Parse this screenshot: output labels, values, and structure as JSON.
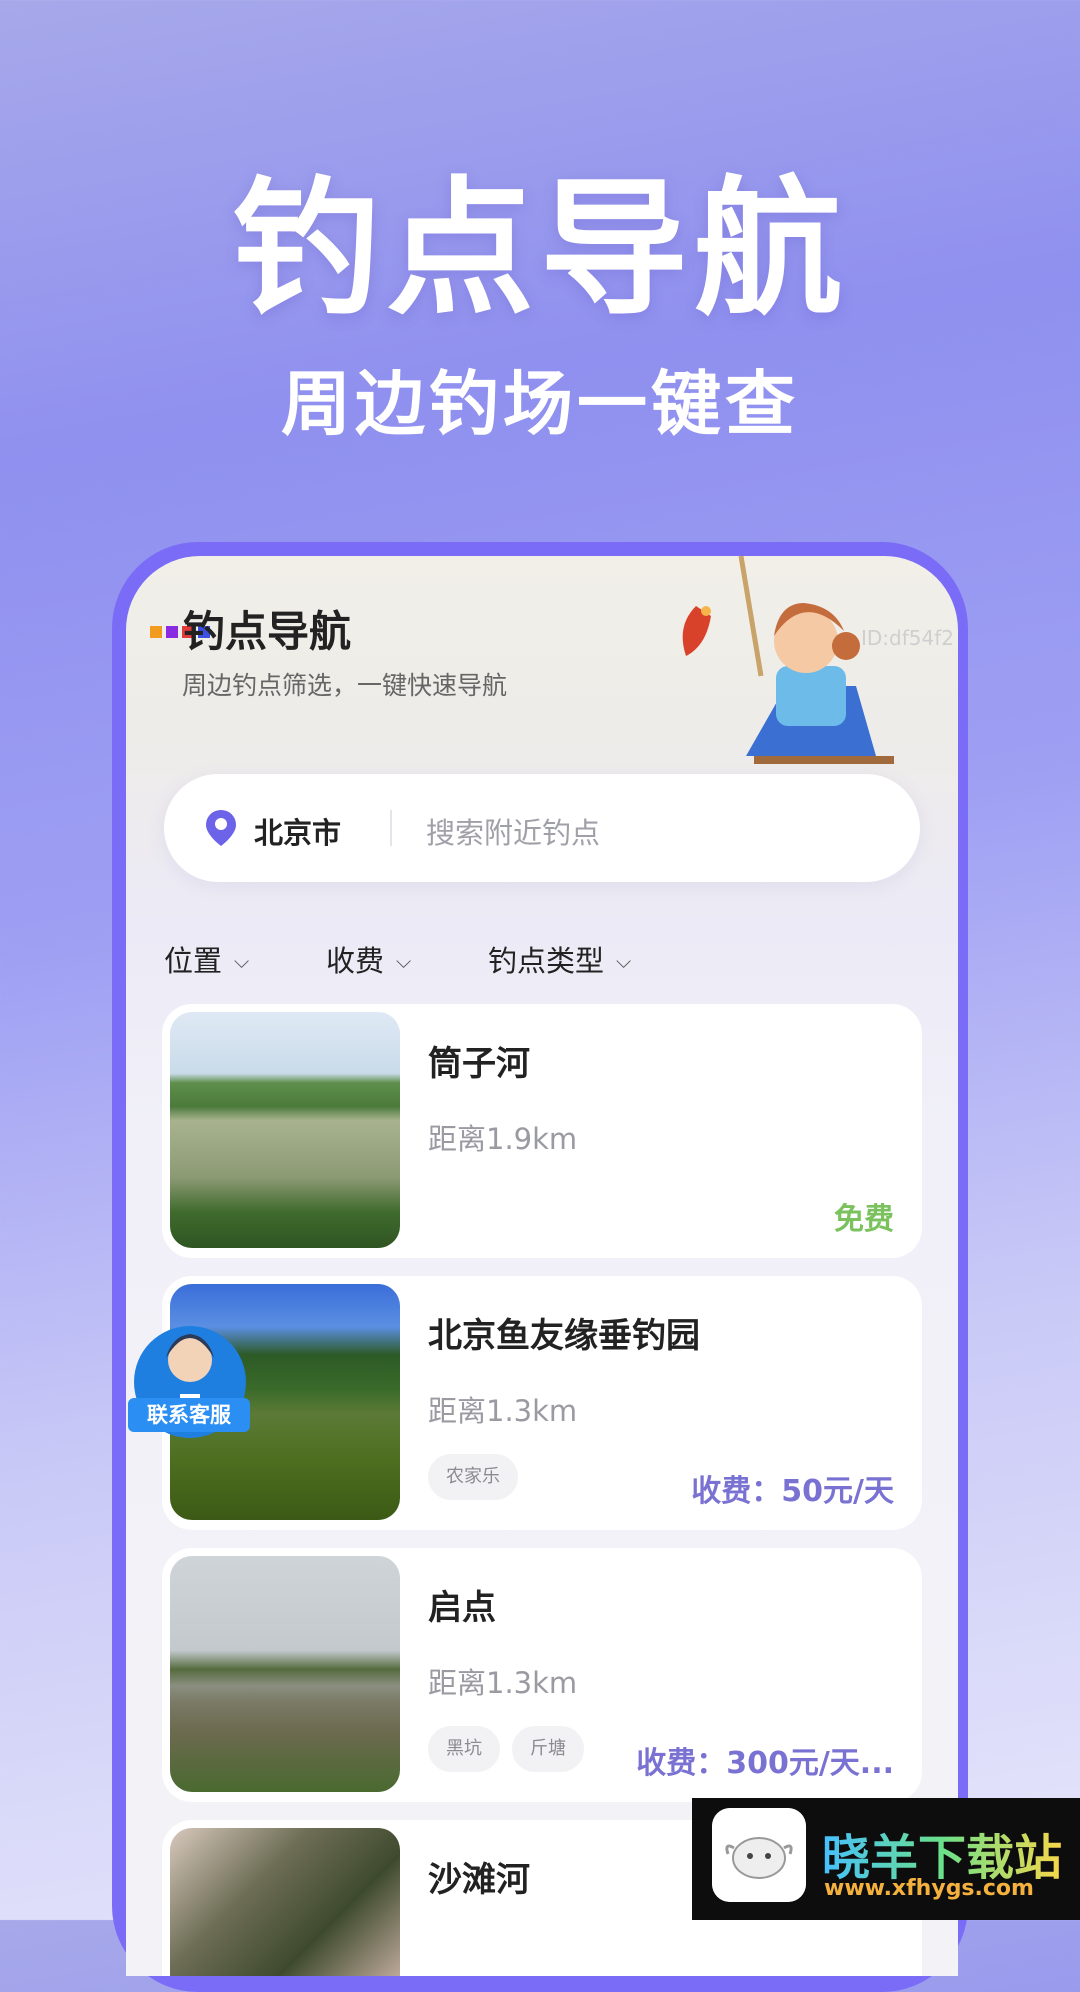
{
  "promo": {
    "title": "钓点导航",
    "subtitle": "周边钓场一键查"
  },
  "app": {
    "title": "钓点导航",
    "subtitle": "周边钓点筛选，一键快速导航",
    "id_text": "ID:df54f2"
  },
  "search": {
    "city": "北京市",
    "placeholder": "搜索附近钓点"
  },
  "filters": [
    {
      "label": "位置"
    },
    {
      "label": "收费"
    },
    {
      "label": "钓点类型"
    }
  ],
  "spots": [
    {
      "name": "筒子河",
      "distance": "距离1.9km",
      "price": "免费",
      "tags": []
    },
    {
      "name": "北京鱼友缘垂钓园",
      "distance": "距离1.3km",
      "price": "收费：50元/天",
      "tags": [
        "农家乐"
      ]
    },
    {
      "name": "启点",
      "distance": "距离1.3km",
      "price": "收费：300元/天...",
      "tags": [
        "黑坑",
        "斤塘"
      ]
    },
    {
      "name": "沙滩河",
      "distance": "",
      "price": "",
      "tags": []
    }
  ],
  "customer_service": {
    "label": "联系客服"
  },
  "site_watermark": {
    "name": "晓羊下载站",
    "url": "www.xfhygs.com"
  },
  "colors": {
    "accent": "#7a6cf6",
    "price_paid": "#7a72d2",
    "price_free": "#7bc25e"
  }
}
